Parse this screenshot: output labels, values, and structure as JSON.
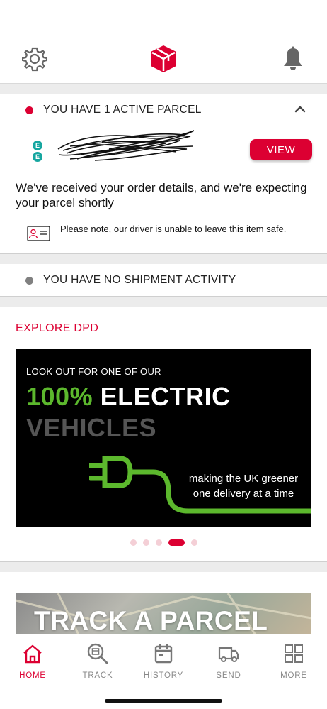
{
  "header": {
    "icons": [
      "gear-icon",
      "dpd-logo",
      "bell-icon"
    ]
  },
  "active": {
    "status": "YOU HAVE 1 ACTIVE PARCEL",
    "status_color": "#dc0032",
    "carrier_badge": "EE",
    "view_label": "VIEW",
    "message": "We've received your order details, and we're expecting your parcel shortly",
    "note": "Please note, our driver is unable to leave this item safe."
  },
  "shipments": {
    "status": "YOU HAVE NO SHIPMENT ACTIVITY",
    "status_color": "#808080"
  },
  "explore": {
    "title": "EXPLORE DPD",
    "banner": {
      "line1": "LOOK OUT FOR ONE OF OUR",
      "highlight": "100%",
      "line2_rest": "ELECTRIC",
      "line3": "VEHICLES",
      "tagline1": "making the UK greener",
      "tagline2": "one delivery at a time"
    },
    "carousel_count": 5,
    "carousel_active": 4
  },
  "track": {
    "text": "TRACK A PARCEL"
  },
  "tabs": [
    {
      "label": "HOME",
      "icon": "home-icon",
      "active": true
    },
    {
      "label": "TRACK",
      "icon": "track-icon",
      "active": false
    },
    {
      "label": "HISTORY",
      "icon": "calendar-icon",
      "active": false
    },
    {
      "label": "SEND",
      "icon": "van-icon",
      "active": false
    },
    {
      "label": "MORE",
      "icon": "grid-icon",
      "active": false
    }
  ],
  "colors": {
    "brand": "#dc0032",
    "green": "#5cb82d"
  }
}
